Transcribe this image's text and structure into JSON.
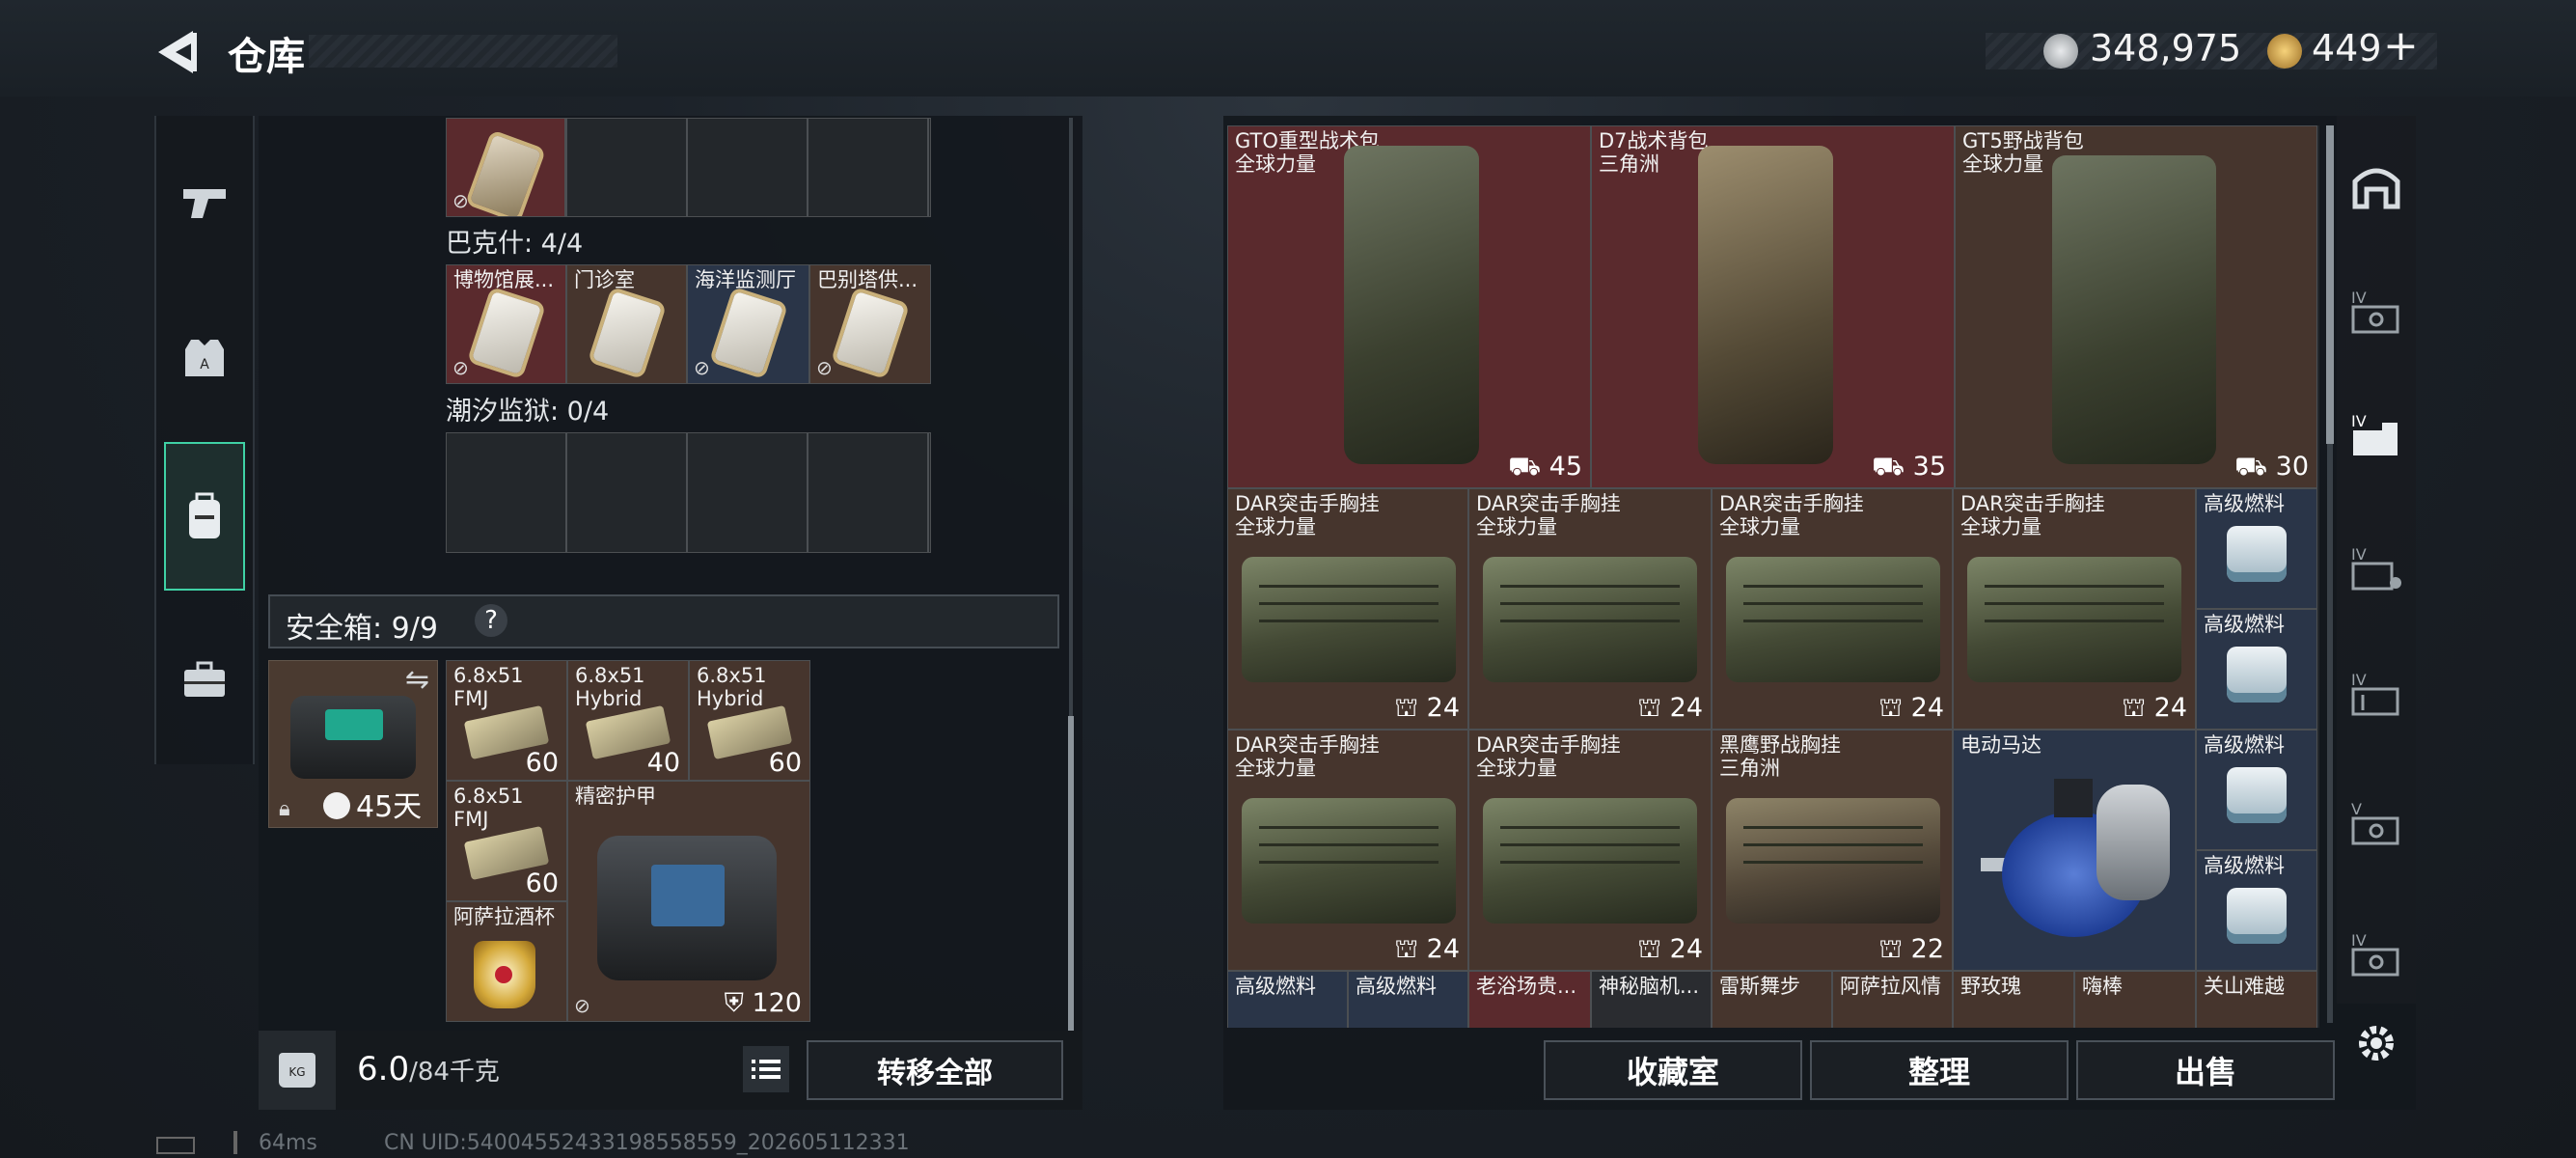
{
  "header": {
    "title": "仓库",
    "currency1": "348,975",
    "currency2": "449",
    "plus": "+"
  },
  "left_tabs": [
    "gun-icon",
    "armor-icon",
    "backpack-icon",
    "briefcase-icon"
  ],
  "sections": {
    "bakshi": "巴克什: 4/4",
    "tide": "潮汐监狱: 0/4"
  },
  "keycards": [
    {
      "label": "博物馆展..."
    },
    {
      "label": "门诊室"
    },
    {
      "label": "海洋监测厅"
    },
    {
      "label": "巴别塔供..."
    }
  ],
  "safe": {
    "label": "安全箱: 9/9",
    "help": "?",
    "days": "45天"
  },
  "safe_items": [
    {
      "label": "6.8x51 FMJ",
      "count": "60"
    },
    {
      "label": "6.8x51 Hybrid",
      "count": "40"
    },
    {
      "label": "6.8x51 Hybrid",
      "count": "60"
    },
    {
      "label": "6.8x51 FMJ",
      "count": "60"
    },
    {
      "label": "精密护甲",
      "count": "120"
    },
    {
      "label": "阿萨拉酒杯"
    }
  ],
  "weight": {
    "value": "6.0",
    "total": "/84千克",
    "transfer": "转移全部"
  },
  "bottom": {
    "ping": "64ms",
    "uid": "CN UID:5400455243319855855​9_202605112331"
  },
  "storage": {
    "backpacks": [
      {
        "name": "GTO重型战术包",
        "sub": "全球力量",
        "count": "45"
      },
      {
        "name": "D7战术背包",
        "sub": "三角洲",
        "count": "35"
      },
      {
        "name": "GT5野战背包",
        "sub": "全球力量",
        "count": "30"
      }
    ],
    "vests_row1": [
      {
        "name": "DAR突击手胸挂",
        "sub": "全球力量",
        "count": "24"
      },
      {
        "name": "DAR突击手胸挂",
        "sub": "全球力量",
        "count": "24"
      },
      {
        "name": "DAR突击手胸挂",
        "sub": "全球力量",
        "count": "24"
      },
      {
        "name": "DAR突击手胸挂",
        "sub": "全球力量",
        "count": "24"
      }
    ],
    "vests_row2": [
      {
        "name": "DAR突击手胸挂",
        "sub": "全球力量",
        "count": "24"
      },
      {
        "name": "DAR突击手胸挂",
        "sub": "全球力量",
        "count": "24"
      },
      {
        "name": "黑鹰野战胸挂",
        "sub": "三角洲",
        "count": "22"
      }
    ],
    "motor": "电动马达",
    "fuel": "高级燃料",
    "bottom_row": [
      "高级燃料",
      "高级燃料",
      "老浴场贵...",
      "神秘脑机...",
      "雷斯舞步",
      "阿萨拉风情",
      "野玫瑰",
      "嗨棒",
      "关山难越"
    ],
    "buttons": {
      "collection": "收藏室",
      "sort": "整理",
      "sell": "出售"
    }
  },
  "colors": {
    "accent": "#3fd1a5",
    "red_cell": "#5a2a2d",
    "brown_cell": "#46352d"
  }
}
